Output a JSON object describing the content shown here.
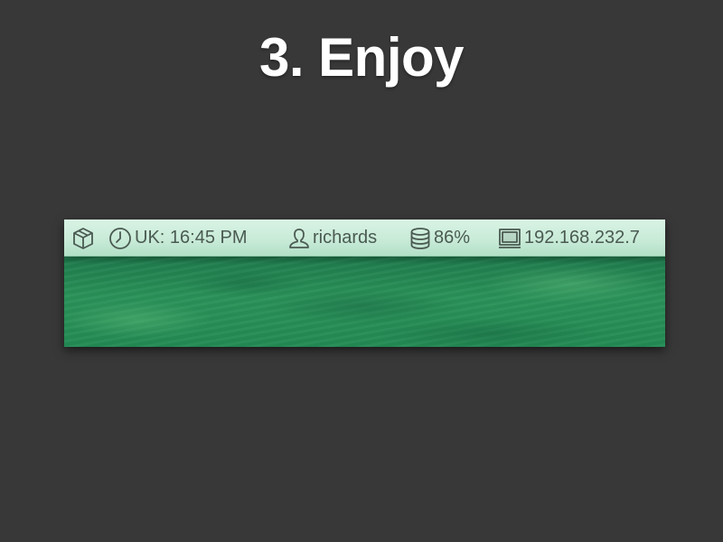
{
  "slide": {
    "title": "3. Enjoy"
  },
  "menubar": {
    "app_icon": "cube-icon",
    "clock": {
      "icon": "clock-icon",
      "text": "UK: 16:45 PM"
    },
    "user": {
      "icon": "user-icon",
      "text": "richards"
    },
    "disk": {
      "icon": "database-icon",
      "text": "86%"
    },
    "network": {
      "icon": "monitor-icon",
      "text": "192.168.232.7"
    }
  },
  "colors": {
    "slide_background": "#383838",
    "title_text": "#ffffff",
    "menubar_background": "#c9ebd8",
    "menubar_text": "#4a5a52",
    "desktop_green": "#238a54"
  }
}
